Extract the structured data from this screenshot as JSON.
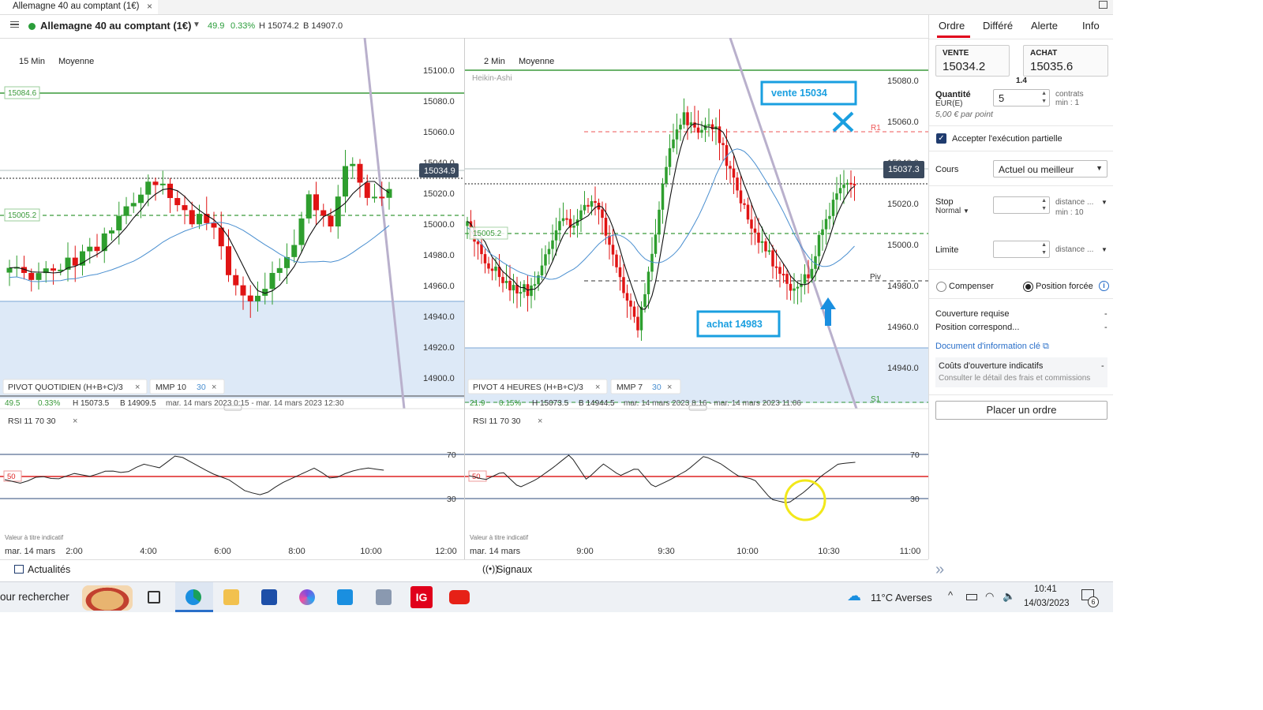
{
  "window": {
    "tab_title": "Allemagne 40 au comptant (1€)",
    "tab_close": "×"
  },
  "header": {
    "instrument": "Allemagne 40 au comptant (1€)",
    "change": "49.9",
    "change_pct": "0.33%",
    "high": "H 15074.2",
    "low": "B 14907.0"
  },
  "left_chart": {
    "timeframe": "15 Min",
    "chart_style": "Moyenne",
    "y_ticks": [
      "15100.0",
      "15080.0",
      "15060.0",
      "15040.0",
      "15020.0",
      "15000.0",
      "14980.0",
      "14960.0",
      "14940.0",
      "14920.0",
      "14900.0"
    ],
    "price_tag": "15034.9",
    "level_tags": [
      "15084.6",
      "15005.2"
    ],
    "pivot_label": "PIVOT  QUOTIDIEN  (H+B+C)/3",
    "mmp_label": "MMP  10",
    "mmp_period": "30",
    "stats": {
      "change": "49.5",
      "pct": "0.33%",
      "high": "H 15073.5",
      "low": "B 14909.5",
      "range": "mar. 14 mars 2023 0:15 - mar. 14 mars 2023 12:30"
    },
    "rsi_label": "RSI  11  70  30",
    "rsi_levels": [
      "70",
      "50",
      "30"
    ],
    "disclaimer": "Valeur à titre indicatif",
    "x_ticks": [
      "mar. 14 mars",
      "2:00",
      "4:00",
      "6:00",
      "8:00",
      "10:00",
      "12:00"
    ]
  },
  "right_chart": {
    "timeframe": "2 Min",
    "chart_style": "Moyenne",
    "sub_label": "Heikin-Ashi",
    "y_ticks": [
      "15080.0",
      "15060.0",
      "15040.0",
      "15020.0",
      "15000.0",
      "14980.0",
      "14960.0",
      "14940.0"
    ],
    "price_tag": "15037.3",
    "level_tag": "15005.2",
    "r1": "R1",
    "piv": "Piv",
    "s1": "S1",
    "annotation_sell": "vente 15034",
    "annotation_buy": "achat 14983",
    "pivot_label": "PIVOT  4 HEURES  (H+B+C)/3",
    "mmp_label": "MMP  7",
    "mmp_period": "30",
    "stats": {
      "change": "21.9",
      "pct": "0.15%",
      "high": "H 15073.5",
      "low": "B 14944.5",
      "range": "mar. 14 mars 2023 8:16 - mar. 14 mars 2023 11:06"
    },
    "rsi_label": "RSI  11  70  30",
    "rsi_levels": [
      "70",
      "50",
      "30"
    ],
    "disclaimer": "Valeur à titre indicatif",
    "x_ticks": [
      "mar. 14 mars",
      "9:00",
      "9:30",
      "10:00",
      "10:30",
      "11:00"
    ]
  },
  "order_panel": {
    "tabs": [
      "Ordre",
      "Différé",
      "Alerte",
      "Info"
    ],
    "sell_label": "VENTE",
    "sell_price": "15034.2",
    "buy_label": "ACHAT",
    "buy_price": "15035.6",
    "spread": "1.4",
    "qty_label": "Quantité",
    "qty_unit": "EUR(E)",
    "qty_value": "5",
    "contracts": "contrats",
    "min_contracts": "min : 1",
    "per_point": "5,00 € par point",
    "partial_exec": "Accepter l'exécution partielle",
    "price_label": "Cours",
    "price_mode": "Actuel ou meilleur",
    "stop_label": "Stop",
    "stop_mode": "Normal",
    "stop_distance": "distance ...",
    "stop_min": "min : 10",
    "limit_label": "Limite",
    "limit_distance": "distance ...",
    "offset_label": "Compenser",
    "forced_label": "Position forcée",
    "margin_label": "Couverture requise",
    "margin_value": "-",
    "position_label": "Position correspond...",
    "position_value": "-",
    "doc_link": "Document d'information clé",
    "costs_label": "Coûts d'ouverture indicatifs",
    "costs_value": "-",
    "costs_link": "Consulter le détail des frais et commissions",
    "place_order": "Placer un ordre"
  },
  "bottom": {
    "news": "Actualités",
    "signals": "Signaux",
    "expand": "»"
  },
  "taskbar": {
    "search": "our rechercher",
    "weather": "11°C  Averses",
    "time": "10:41",
    "date": "14/03/2023",
    "notifications": "6",
    "ig_label": "IG"
  },
  "colors": {
    "bull": "#2e9e2e",
    "bear": "#e01414",
    "pivot_zone": "#dde9f7",
    "annotation": "#1a9fe0",
    "rsi_circle": "#f2e81a",
    "accent_red": "#e0001b"
  }
}
